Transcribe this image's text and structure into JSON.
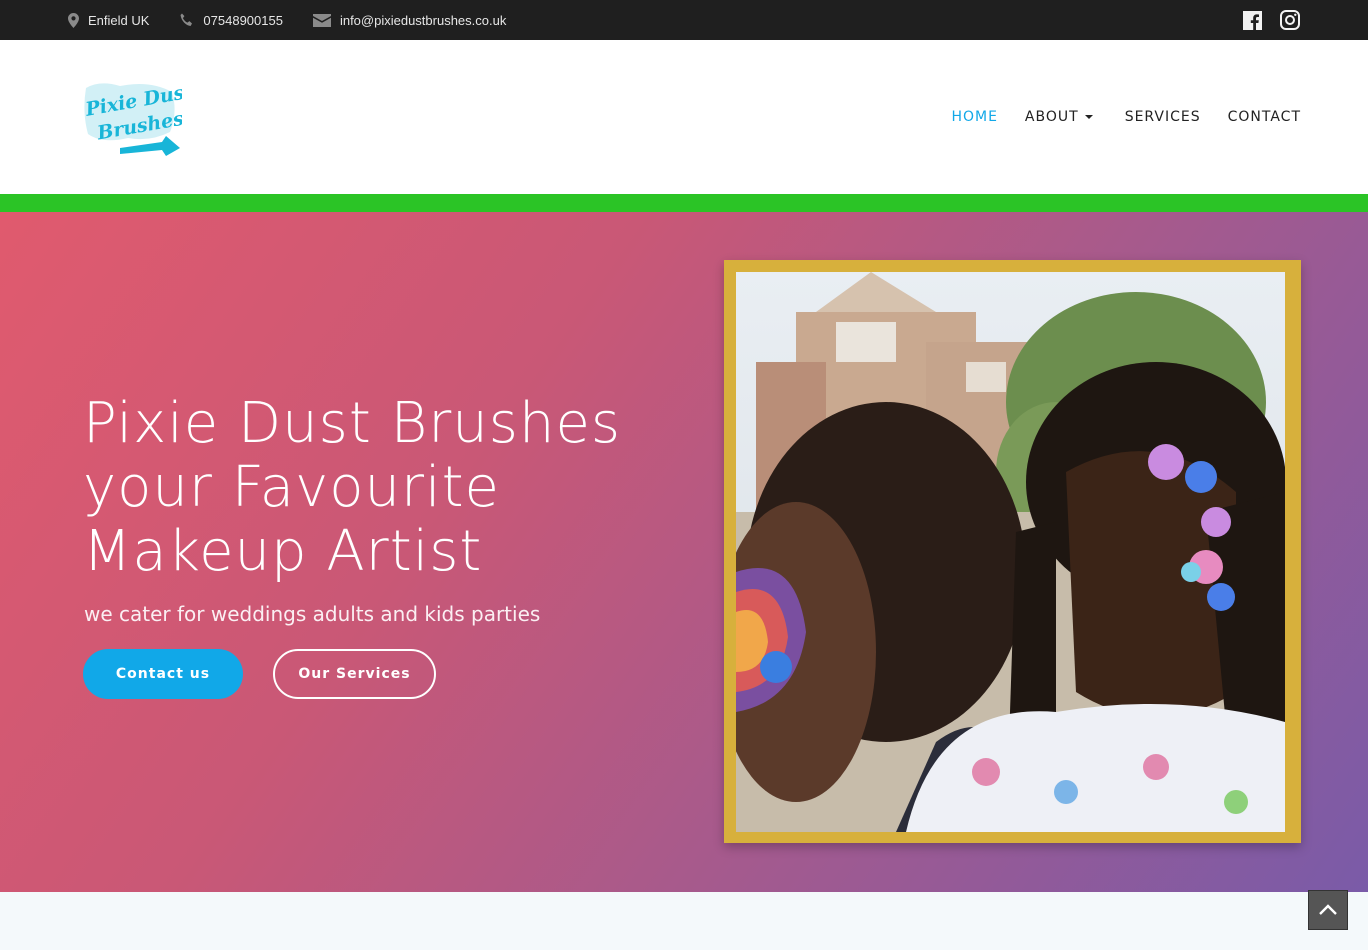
{
  "topbar": {
    "location": "Enfield UK",
    "phone": "07548900155",
    "email": "info@pixiedustbrushes.co.uk",
    "icons": [
      "map-marker-icon",
      "phone-icon",
      "envelope-icon",
      "facebook-icon",
      "instagram-icon"
    ]
  },
  "logo": {
    "text_line1": "Pixie Dust",
    "text_line2": "Brushes",
    "color": "#18b5d8"
  },
  "nav": {
    "items": [
      {
        "label": "HOME",
        "active": true
      },
      {
        "label": "ABOUT",
        "has_dropdown": true
      },
      {
        "label": "SERVICES"
      },
      {
        "label": "CONTACT"
      }
    ]
  },
  "hero": {
    "title": "Pixie Dust Brushes your Favourite Makeup Artist",
    "subtitle": "we cater for weddings adults and kids parties",
    "primary_button": "Contact us",
    "secondary_button": "Our Services"
  },
  "colors": {
    "accent": "#11a8e8",
    "green_bar": "#2bc426",
    "frame_gold": "#d7b03c",
    "topbar_bg": "#1f1f1f"
  }
}
